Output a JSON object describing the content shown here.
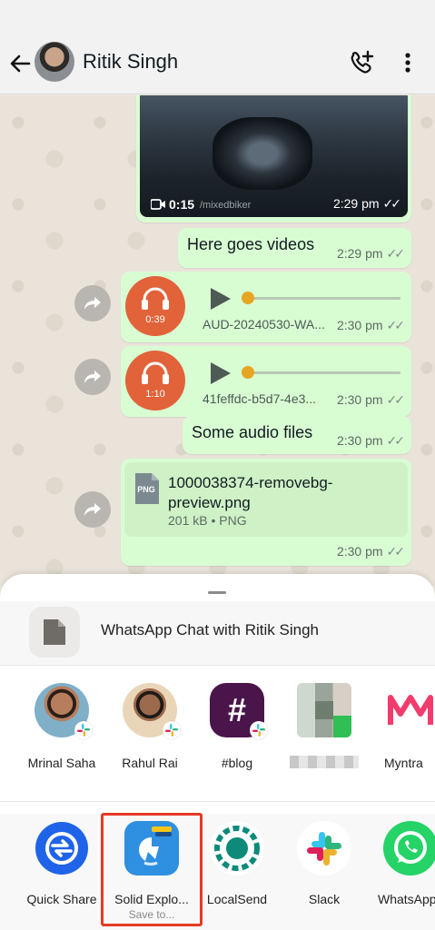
{
  "header": {
    "contact_name": "Ritik Singh"
  },
  "messages": {
    "video": {
      "duration": "0:15",
      "handle": "/mixedbiker",
      "time": "2:29 pm"
    },
    "text1": {
      "text": "Here goes videos",
      "time": "2:29 pm"
    },
    "audio1": {
      "length": "0:39",
      "name": "AUD-20240530-WA...",
      "time": "2:30 pm"
    },
    "audio2": {
      "length": "1:10",
      "name": "41feffdc-b5d7-4e3...",
      "time": "2:30 pm"
    },
    "text2": {
      "text": "Some audio files",
      "time": "2:30 pm"
    },
    "file": {
      "name": "1000038374-removebg-preview.png",
      "info": "201 kB • PNG",
      "icon_label": "PNG",
      "time": "2:30 pm"
    }
  },
  "share_sheet": {
    "title": "WhatsApp Chat with Ritik Singh",
    "targets": [
      {
        "label": "Mrinal Saha"
      },
      {
        "label": "Rahul Rai"
      },
      {
        "label": "#blog"
      },
      {
        "label": ""
      },
      {
        "label": "Myntra"
      }
    ],
    "apps": [
      {
        "label": "Quick Share"
      },
      {
        "label": "Solid Explo...",
        "sublabel": "Save to..."
      },
      {
        "label": "LocalSend"
      },
      {
        "label": "Slack"
      },
      {
        "label": "WhatsApp"
      }
    ]
  },
  "colors": {
    "bubble": "#d9fdd3",
    "audio_accent": "#e2623a",
    "highlight": "#e63a26"
  }
}
